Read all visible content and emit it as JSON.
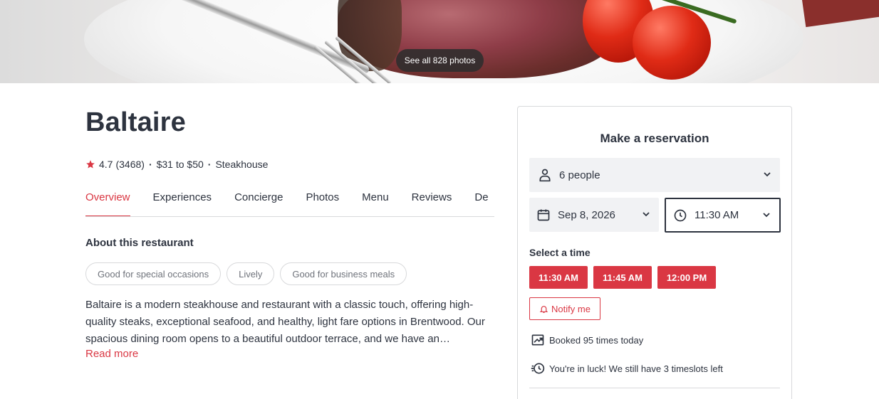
{
  "hero": {
    "photos_button": "See all 828 photos"
  },
  "restaurant": {
    "name": "Baltaire",
    "rating": "4.7",
    "reviews_count": "(3468)",
    "price_range": "$31 to $50",
    "cuisine": "Steakhouse",
    "star_color": "#da3743"
  },
  "tabs": [
    {
      "label": "Overview",
      "active": true
    },
    {
      "label": "Experiences"
    },
    {
      "label": "Concierge"
    },
    {
      "label": "Photos"
    },
    {
      "label": "Menu"
    },
    {
      "label": "Reviews"
    },
    {
      "label": "De"
    }
  ],
  "about": {
    "heading": "About this restaurant",
    "tags": [
      "Good for special occasions",
      "Lively",
      "Good for business meals"
    ],
    "description": "Baltaire is a modern steakhouse and restaurant with a classic touch, offering high-quality steaks, exceptional seafood, and healthy, light fare options in Brentwood. Our spacious dining room opens to a beautiful outdoor terrace, and we have an…",
    "read_more": "Read more"
  },
  "reservation": {
    "title": "Make a reservation",
    "party_size": "6 people",
    "date": "Sep 8, 2026",
    "time": "11:30 AM",
    "select_time_label": "Select a time",
    "slots": [
      "11:30 AM",
      "11:45 AM",
      "12:00 PM"
    ],
    "notify_label": "Notify me",
    "booked_text": "Booked 95 times today",
    "luck_text": "You're in luck! We still have 3 timeslots left",
    "accent_color": "#da3743"
  }
}
